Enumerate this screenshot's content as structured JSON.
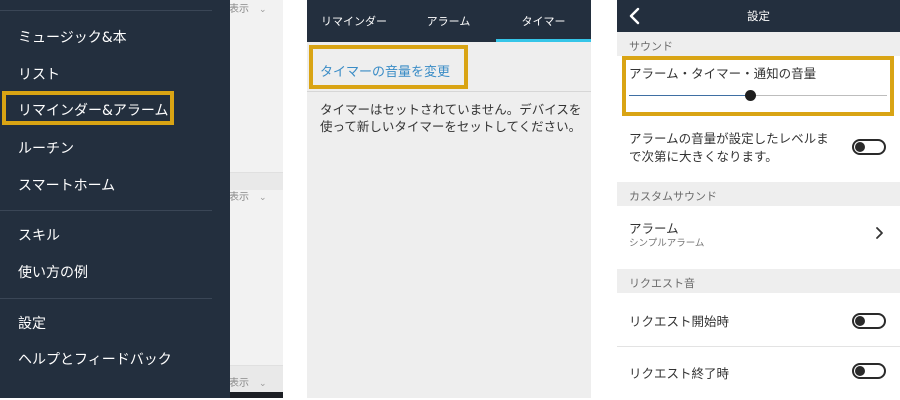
{
  "menu_panel": {
    "items": [
      {
        "label": "ミュージック&本"
      },
      {
        "label": "リスト"
      },
      {
        "label": "リマインダー&アラーム",
        "highlighted": true
      },
      {
        "label": "ルーチン"
      },
      {
        "label": "スマートホーム"
      },
      {
        "label": "スキル"
      },
      {
        "label": "使い方の例"
      },
      {
        "label": "設定"
      },
      {
        "label": "ヘルプとフィードバック"
      }
    ],
    "background_text": {
      "label": "表示"
    }
  },
  "timer_panel": {
    "tabs": [
      {
        "label": "リマインダー"
      },
      {
        "label": "アラーム"
      },
      {
        "label": "タイマー",
        "active": true
      }
    ],
    "change_volume_link": "タイマーの音量を変更",
    "empty_message": "タイマーはセットされていません。デバイスを使って新しいタイマーをセットしてください。"
  },
  "settings_panel": {
    "title": "設定",
    "back_icon": "chevron-left-icon",
    "sections": {
      "sound": "サウンド",
      "custom_sound": "カスタムサウンド",
      "request_sound": "リクエスト音"
    },
    "volume": {
      "label": "アラーム・タイマー・通知の音量",
      "level": 0.47
    },
    "ascending_alarm": {
      "label_line1": "アラームの音量が設定したレベルま",
      "label_line2": "で次第に大きくなります。",
      "enabled": false
    },
    "alarm_sound": {
      "label": "アラーム",
      "value": "シンプルアラーム"
    },
    "request_start": {
      "label": "リクエスト開始時",
      "enabled": false
    },
    "request_end": {
      "label": "リクエスト終了時",
      "enabled": false
    }
  },
  "colors": {
    "nav_dark": "#232f3e",
    "highlight": "#d9a414",
    "tab_underline": "#35c5e8",
    "link_blue": "#3a8cc6"
  }
}
